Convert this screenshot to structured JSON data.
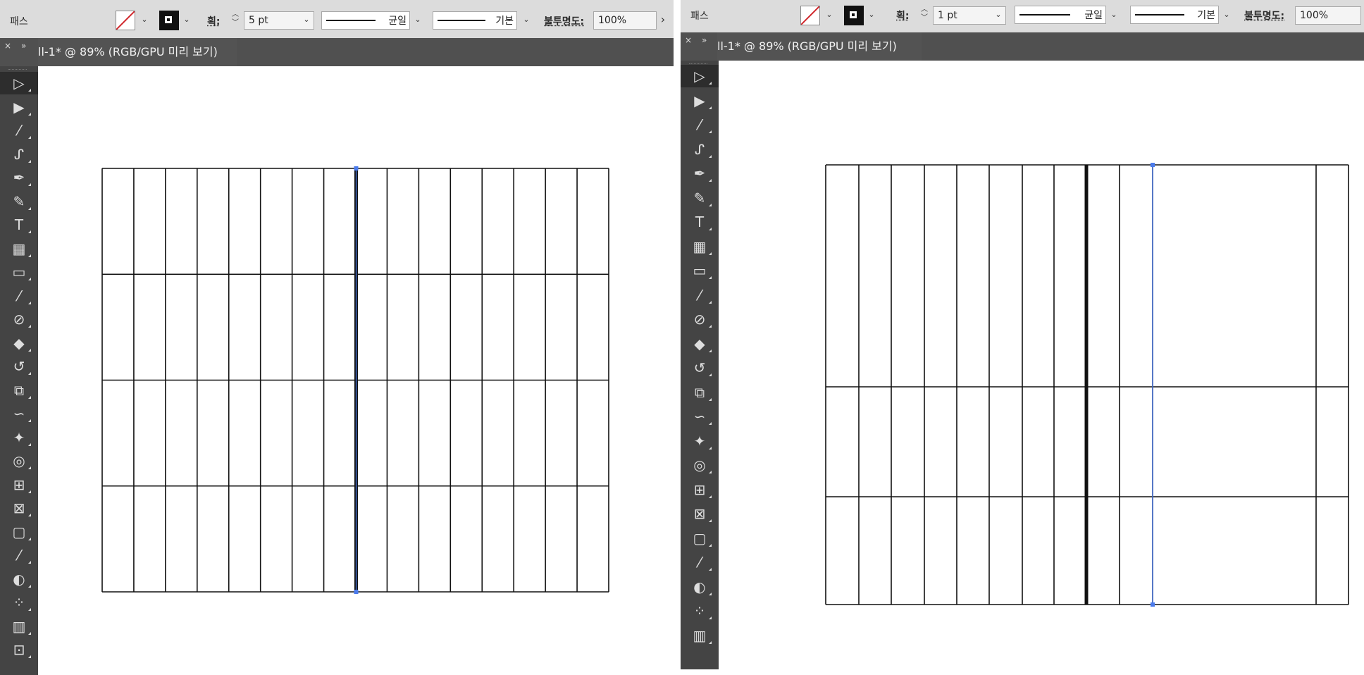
{
  "left": {
    "control_bar": {
      "object_type": "패스",
      "stroke_label": "획:",
      "stroke_value": "5 pt",
      "profile_label": "균일",
      "brush_label": "기본",
      "opacity_label": "불투명도:",
      "opacity_value": "100%"
    },
    "document_tab": {
      "title": "ll-1* @ 89% (RGB/GPU 미리 보기)",
      "close": "×",
      "collapse": "»"
    }
  },
  "right": {
    "control_bar": {
      "object_type": "패스",
      "stroke_label": "획:",
      "stroke_value": "1 pt",
      "profile_label": "균일",
      "brush_label": "기본",
      "opacity_label": "불투명도:",
      "opacity_value": "100%"
    },
    "document_tab": {
      "title": "ll-1* @ 89% (RGB/GPU 미리 보기)",
      "close": "×",
      "collapse": "»"
    }
  },
  "tools": [
    {
      "name": "selection-tool-icon",
      "glyph": "▷"
    },
    {
      "name": "direct-selection-tool-icon",
      "glyph": "▶"
    },
    {
      "name": "magic-wand-tool-icon",
      "glyph": "⁄"
    },
    {
      "name": "lasso-tool-icon",
      "glyph": "ᔑ"
    },
    {
      "name": "pen-tool-icon",
      "glyph": "✒"
    },
    {
      "name": "curvature-tool-icon",
      "glyph": "✎"
    },
    {
      "name": "type-tool-icon",
      "glyph": "T"
    },
    {
      "name": "table-tool-icon",
      "glyph": "▦"
    },
    {
      "name": "rectangle-tool-icon",
      "glyph": "▭"
    },
    {
      "name": "paintbrush-tool-icon",
      "glyph": "⁄"
    },
    {
      "name": "blob-brush-tool-icon",
      "glyph": "⊘"
    },
    {
      "name": "eraser-tool-icon",
      "glyph": "◆"
    },
    {
      "name": "rotate-tool-icon",
      "glyph": "↺"
    },
    {
      "name": "scale-tool-icon",
      "glyph": "⧉"
    },
    {
      "name": "warp-tool-icon",
      "glyph": "∽"
    },
    {
      "name": "puppet-warp-tool-icon",
      "glyph": "✦"
    },
    {
      "name": "shape-builder-tool-icon",
      "glyph": "◎"
    },
    {
      "name": "perspective-grid-tool-icon",
      "glyph": "⊞"
    },
    {
      "name": "mesh-tool-icon",
      "glyph": "⊠"
    },
    {
      "name": "gradient-tool-icon",
      "glyph": "▢"
    },
    {
      "name": "eyedropper-tool-icon",
      "glyph": "⁄"
    },
    {
      "name": "blend-tool-icon",
      "glyph": "◐"
    },
    {
      "name": "symbol-sprayer-tool-icon",
      "glyph": "⁘"
    },
    {
      "name": "column-graph-tool-icon",
      "glyph": "▥"
    },
    {
      "name": "artboard-tool-icon",
      "glyph": "⊡"
    }
  ],
  "colors": {
    "toolbar_bg": "#444444",
    "tab_bg": "#505050",
    "control_bar_bg": "#dcdcdc",
    "selection_blue": "#4b7bec",
    "fill_none_red": "#d0262b"
  }
}
